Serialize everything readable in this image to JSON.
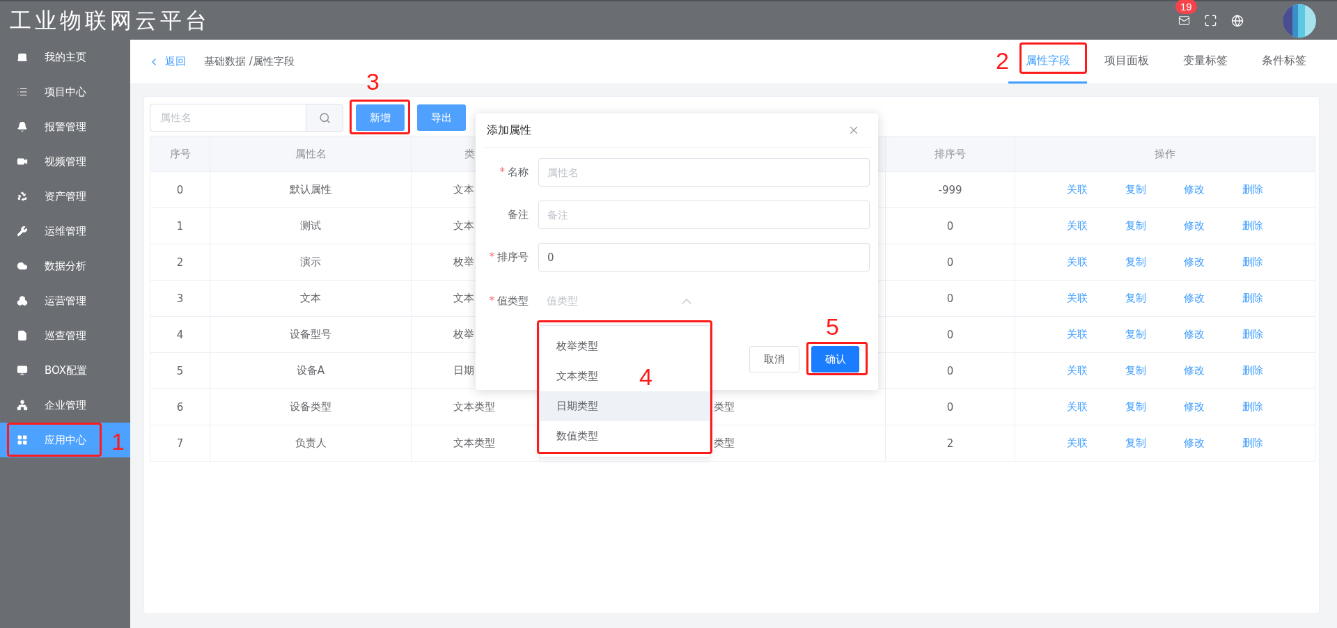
{
  "header": {
    "title": "工业物联网云平台",
    "mail_badge": "19"
  },
  "sidebar": {
    "items": [
      {
        "label": "我的主页",
        "selected": false
      },
      {
        "label": "项目中心",
        "selected": false
      },
      {
        "label": "报警管理",
        "selected": false
      },
      {
        "label": "视频管理",
        "selected": false
      },
      {
        "label": "资产管理",
        "selected": false
      },
      {
        "label": "运维管理",
        "selected": false
      },
      {
        "label": "数据分析",
        "selected": false
      },
      {
        "label": "运营管理",
        "selected": false
      },
      {
        "label": "巡查管理",
        "selected": false
      },
      {
        "label": "BOX配置",
        "selected": false
      },
      {
        "label": "企业管理",
        "selected": false
      },
      {
        "label": "应用中心",
        "selected": true
      }
    ]
  },
  "breadcrumb": {
    "back": "返回",
    "path": "基础数据 /属性字段"
  },
  "tabs": [
    {
      "label": "属性字段",
      "selected": true
    },
    {
      "label": "项目面板",
      "selected": false
    },
    {
      "label": "变量标签",
      "selected": false
    },
    {
      "label": "条件标签",
      "selected": false
    }
  ],
  "toolbar": {
    "search": {
      "placeholder": "属性名"
    },
    "buttons": [
      "新增",
      "导出"
    ]
  },
  "table": {
    "columns": [
      {
        "kind": "text",
        "label": "序号"
      },
      {
        "kind": "text",
        "label": "属性名"
      },
      {
        "kind": "text",
        "label": "类"
      },
      {
        "kind": "covered"
      },
      {
        "kind": "text",
        "label": "排序号"
      },
      {
        "kind": "text",
        "label": "操作"
      }
    ],
    "rows": [
      {
        "index": "0",
        "name": "默认属性",
        "column_3": "文本",
        "order": "-999",
        "actions": [
          "关联",
          "复制",
          "修改",
          "删除"
        ]
      },
      {
        "index": "1",
        "name": "测试",
        "column_3": "文本",
        "order": "0",
        "actions": [
          "关联",
          "复制",
          "修改",
          "删除"
        ]
      },
      {
        "index": "2",
        "name": "演示",
        "column_3": "枚举",
        "order": "0",
        "actions": [
          "关联",
          "复制",
          "修改",
          "删除"
        ]
      },
      {
        "index": "3",
        "name": "文本",
        "column_3": "文本",
        "order": "0",
        "actions": [
          "关联",
          "复制",
          "修改",
          "删除"
        ]
      },
      {
        "index": "4",
        "name": "设备型号",
        "column_3": "枚举",
        "order": "0",
        "actions": [
          "关联",
          "复制",
          "修改",
          "删除"
        ]
      },
      {
        "index": "5",
        "name": "设备A",
        "column_3": "日期",
        "order": "0",
        "actions": [
          "关联",
          "复制",
          "修改",
          "删除"
        ]
      },
      {
        "index": "6",
        "name": "设备类型",
        "column_3": "文本类型",
        "column_4": "类型",
        "order": "0",
        "actions": [
          "关联",
          "复制",
          "修改",
          "删除"
        ]
      },
      {
        "index": "7",
        "name": "负责人",
        "column_3": "文本类型",
        "column_4": "类型",
        "order": "2",
        "actions": [
          "关联",
          "复制",
          "修改",
          "删除"
        ]
      }
    ]
  },
  "dialog": {
    "title": "添加属性",
    "fields": [
      {
        "kind": "input",
        "required_mark": "*",
        "label": "名称",
        "placeholder": "属性名"
      },
      {
        "kind": "input",
        "label": "备注",
        "placeholder": "备注"
      },
      {
        "kind": "input",
        "required_mark": "*",
        "label": "排序号",
        "value": "0"
      },
      {
        "kind": "select",
        "required_mark": "*",
        "label": "值类型",
        "placeholder": "值类型",
        "expanded": true
      }
    ],
    "options": [
      {
        "label": "枚举类型",
        "highlighted": false
      },
      {
        "label": "文本类型",
        "highlighted": false
      },
      {
        "label": "日期类型",
        "highlighted": true
      },
      {
        "label": "数值类型",
        "highlighted": false
      }
    ],
    "buttons": [
      {
        "kind": "default",
        "label": "取消"
      },
      {
        "kind": "primary",
        "label": "确认"
      }
    ]
  },
  "annotations": [
    {
      "label": "1"
    },
    {
      "label": "2"
    },
    {
      "label": "3"
    },
    {
      "label": "4"
    },
    {
      "label": "5"
    }
  ]
}
